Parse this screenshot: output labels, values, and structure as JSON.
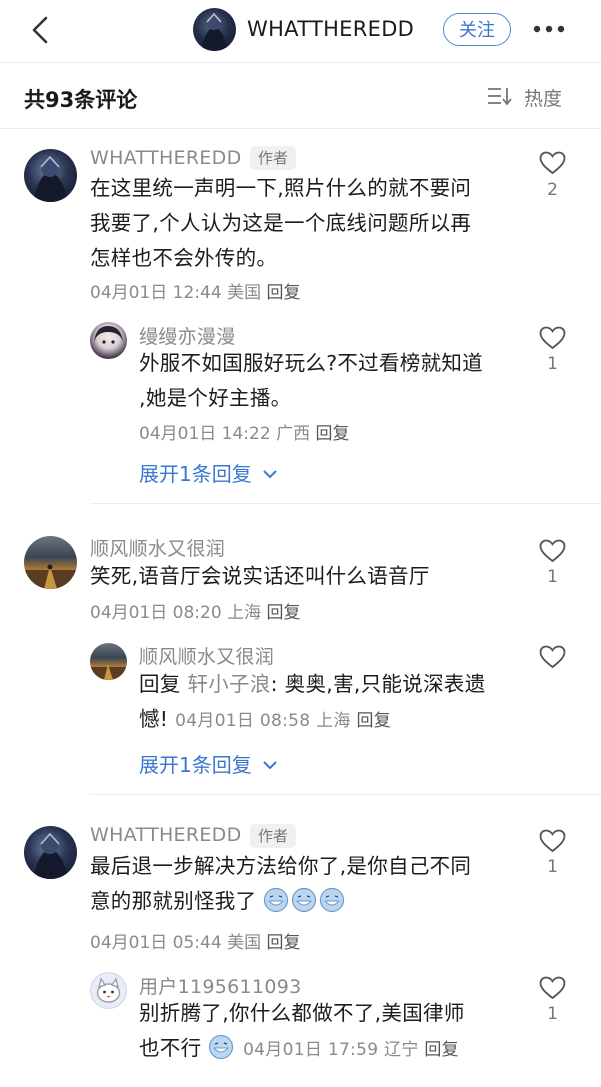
{
  "header": {
    "author_name": "WHATTHEREDD",
    "follow_label": "关注"
  },
  "comments_header": {
    "count_label": "共93条评论",
    "sort_label": "热度"
  },
  "comments": [
    {
      "user": "WHATTHEREDD",
      "badge": "作者",
      "text_lines": [
        "在这里统一声明一下,照片什么的就不要问",
        "我要了,个人认为这是一个底线问题所以再",
        "怎样也不会外传的。"
      ],
      "date": "04月01日 12:44",
      "location": "美国",
      "reply_label": "回复",
      "likes": "2",
      "sub_reply": {
        "user": "缦缦亦漫漫",
        "text_lines": [
          "外服不如国服好玩么?不过看榜就知道",
          ",她是个好主播。"
        ],
        "date": "04月01日 14:22",
        "location": "广西",
        "reply_label": "回复",
        "likes": "1"
      },
      "expand_label": "展开1条回复"
    },
    {
      "user": "顺风顺水又很润",
      "text_lines": [
        "笑死,语音厅会说实话还叫什么语音厅"
      ],
      "date": "04月01日 08:20",
      "location": "上海",
      "reply_label": "回复",
      "likes": "1",
      "sub_reply": {
        "user": "顺风顺水又很润",
        "reply_prefix": "回复",
        "mention": "轩小子浪",
        "text_line1": ": 奥奥,害,只能说深表遗",
        "text_line2": "憾!",
        "date": "04月01日 08:58",
        "location": "上海",
        "reply_label": "回复"
      },
      "expand_label": "展开1条回复"
    },
    {
      "user": "WHATTHEREDD",
      "badge": "作者",
      "text_lines": [
        "最后退一步解决方法给你了,是你自己不同",
        "意的那就别怪我了"
      ],
      "date": "04月01日 05:44",
      "location": "美国",
      "reply_label": "回复",
      "likes": "1",
      "sub_reply": {
        "user": "用户1195611093",
        "text_lines": [
          "别折腾了,你什么都做不了,美国律师",
          "也不行"
        ],
        "date": "04月01日 17:59",
        "location": "辽宁",
        "reply_label": "回复",
        "likes": "1"
      }
    }
  ]
}
